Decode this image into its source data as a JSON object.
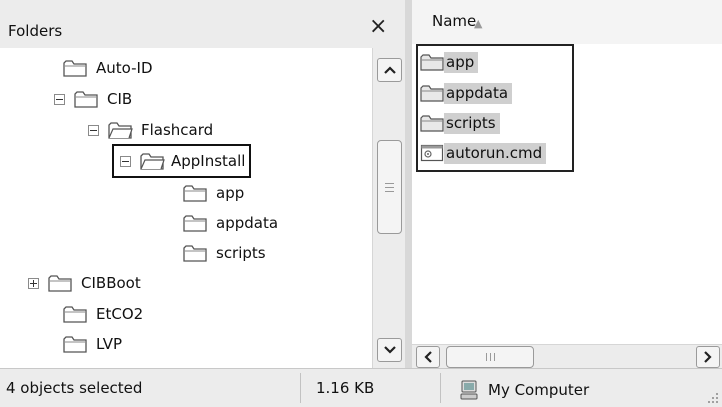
{
  "folders_pane": {
    "title": "Folders",
    "close_glyph": "×",
    "tree": [
      {
        "label": "Auto-ID",
        "expander": "none"
      },
      {
        "label": "CIB",
        "expander": "minus"
      },
      {
        "label": "Flashcard",
        "expander": "minus"
      },
      {
        "label": "AppInstall",
        "expander": "minus",
        "selected": true
      },
      {
        "label": "app",
        "expander": "none"
      },
      {
        "label": "appdata",
        "expander": "none"
      },
      {
        "label": "scripts",
        "expander": "none"
      },
      {
        "label": "CIBBoot",
        "expander": "plus"
      },
      {
        "label": "EtCO2",
        "expander": "none"
      },
      {
        "label": "LVP",
        "expander": "none"
      }
    ]
  },
  "file_pane": {
    "column_name": "Name",
    "sort": "ascending",
    "files": [
      {
        "label": "app",
        "icon": "folder-icon"
      },
      {
        "label": "appdata",
        "icon": "folder-icon"
      },
      {
        "label": "scripts",
        "icon": "folder-icon"
      },
      {
        "label": "autorun.cmd",
        "icon": "cmd-file-icon"
      }
    ]
  },
  "statusbar": {
    "selection": "4 objects selected",
    "size": "1.16 KB",
    "location": "My Computer"
  }
}
